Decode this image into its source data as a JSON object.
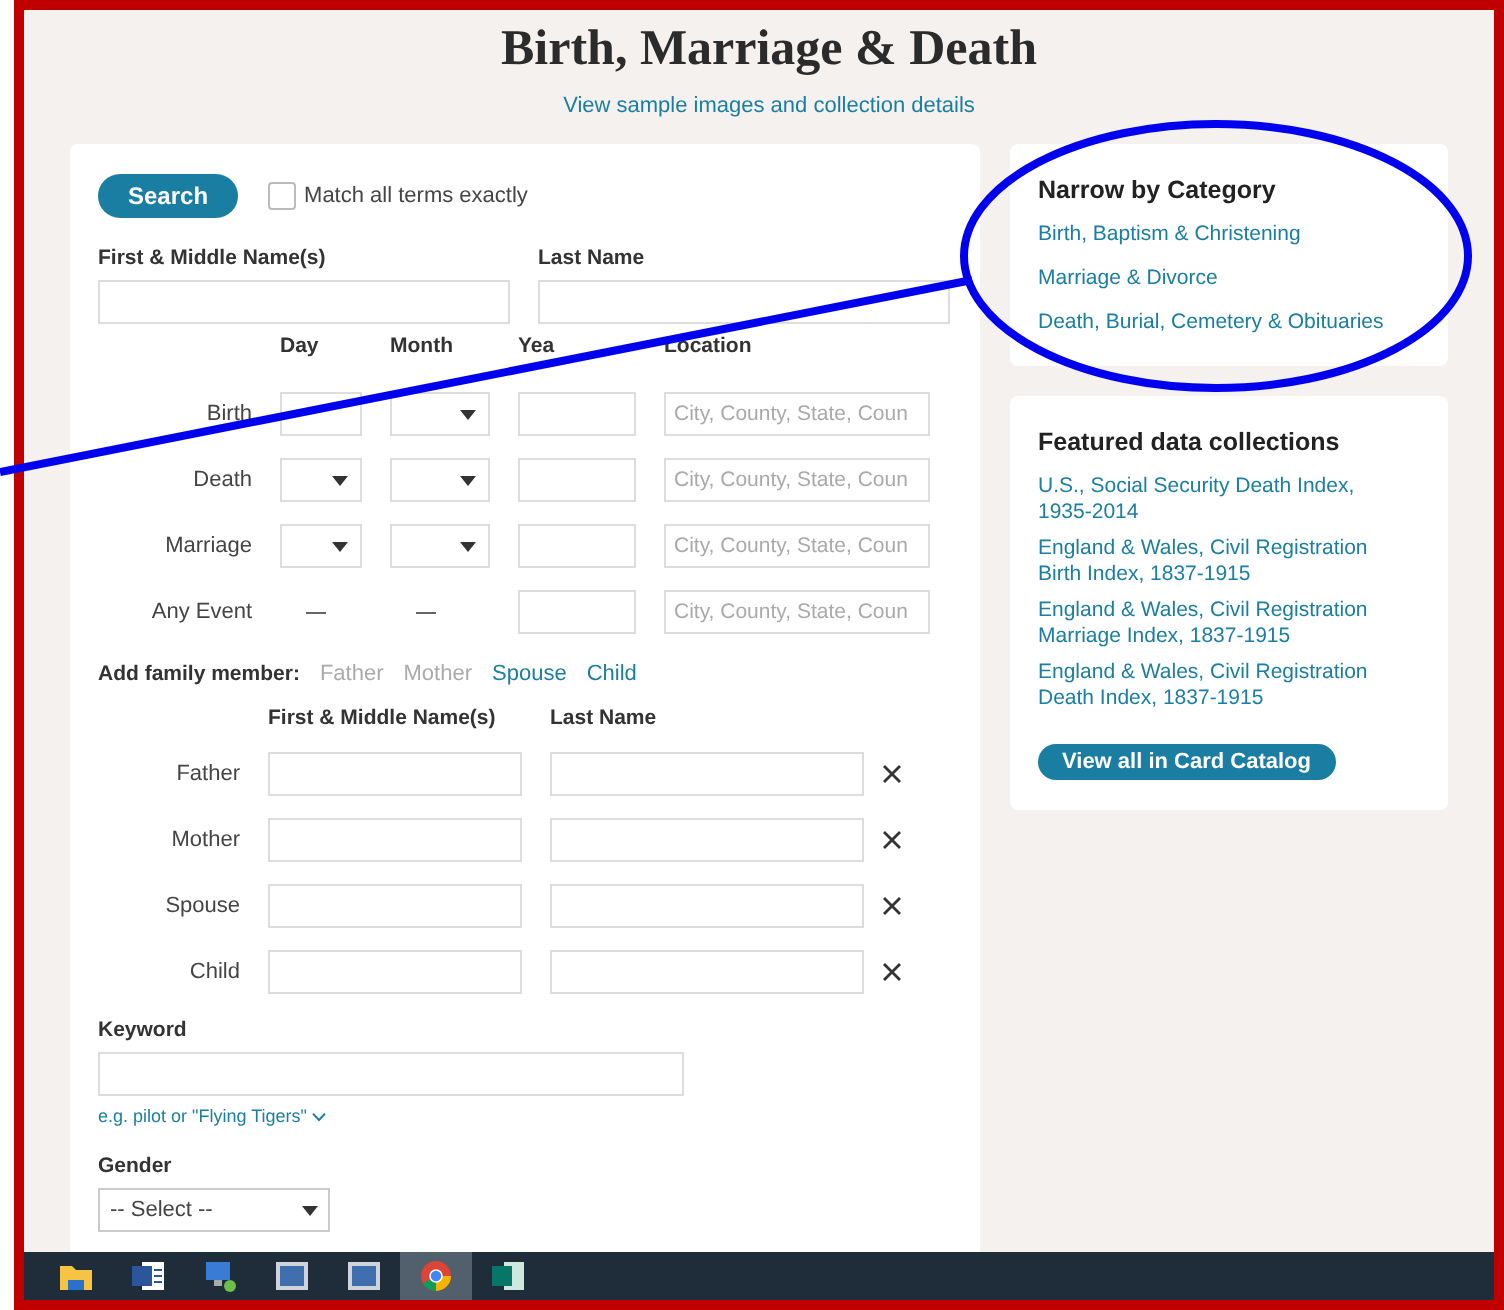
{
  "title": "Birth, Marriage & Death",
  "details_link": "View sample images and collection details",
  "search": {
    "button": "Search",
    "match_exact": {
      "label": "Match all terms exactly",
      "checked": false
    }
  },
  "name_fields": [
    {
      "label": "First & Middle Name(s)"
    },
    {
      "label": "Last Name"
    }
  ],
  "event_columns": [
    "Day",
    "Month",
    "Yea",
    "Location"
  ],
  "events": [
    {
      "label": "Birth",
      "day": {
        "kind": "input"
      },
      "month": {
        "kind": "select"
      },
      "location_placeholder": "City, County, State, Coun"
    },
    {
      "label": "Death",
      "day": {
        "kind": "select"
      },
      "month": {
        "kind": "select"
      },
      "location_placeholder": "City, County, State, Coun"
    },
    {
      "label": "Marriage",
      "day": {
        "kind": "select"
      },
      "month": {
        "kind": "select"
      },
      "location_placeholder": "City, County, State, Coun"
    },
    {
      "label": "Any Event",
      "day": {
        "kind": "none"
      },
      "month": {
        "kind": "none"
      },
      "location_placeholder": "City, County, State, Coun"
    }
  ],
  "family": {
    "label": "Add family member:",
    "links": [
      {
        "label": "Father",
        "disabled": true
      },
      {
        "label": "Mother",
        "disabled": true
      },
      {
        "label": "Spouse",
        "disabled": false
      },
      {
        "label": "Child",
        "disabled": false
      }
    ],
    "columns": [
      "First & Middle Name(s)",
      "Last Name"
    ],
    "rows": [
      {
        "label": "Father"
      },
      {
        "label": "Mother"
      },
      {
        "label": "Spouse"
      },
      {
        "label": "Child"
      }
    ]
  },
  "keyword": {
    "label": "Keyword",
    "hint": "e.g. pilot or \"Flying Tigers\""
  },
  "gender": {
    "label": "Gender",
    "value": "-- Select --"
  },
  "categories": {
    "title": "Narrow by Category",
    "items": [
      "Birth, Baptism & Christening",
      "Marriage & Divorce",
      "Death, Burial, Cemetery & Obituaries"
    ]
  },
  "featured": {
    "title": "Featured data collections",
    "items": [
      "U.S., Social Security Death Index, 1935-2014",
      "England & Wales, Civil Registration Birth Index, 1837-1915",
      "England & Wales, Civil Registration Marriage Index, 1837-1915",
      "England & Wales, Civil Registration Death Index, 1837-1915"
    ],
    "button": "View all in Card Catalog"
  },
  "taskbar": [
    {
      "kind": "folder",
      "selected": false
    },
    {
      "kind": "word",
      "selected": false
    },
    {
      "kind": "network",
      "selected": false
    },
    {
      "kind": "document",
      "selected": false
    },
    {
      "kind": "document",
      "selected": false
    },
    {
      "kind": "browser",
      "selected": true
    },
    {
      "kind": "publisher",
      "selected": false
    }
  ]
}
